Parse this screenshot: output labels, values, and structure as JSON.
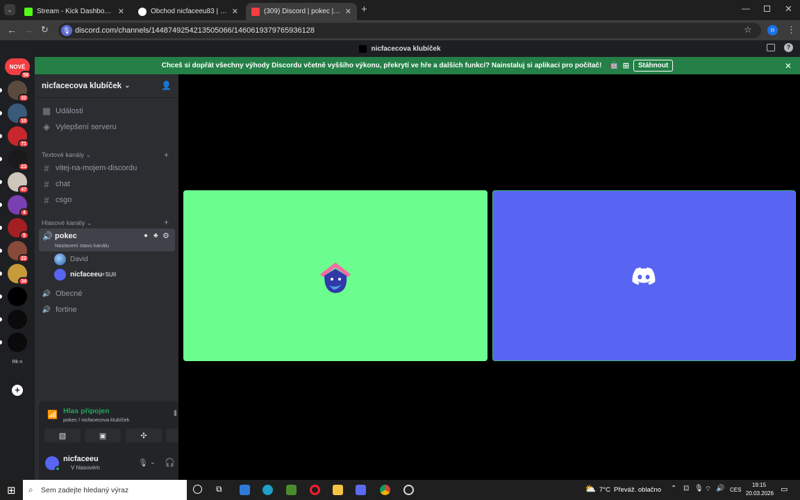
{
  "browser": {
    "tabs": [
      {
        "title": "Stream - Kick Dashboard",
        "active": false
      },
      {
        "title": "Obchod nicfaceeu83 | Nejlepší",
        "active": false
      },
      {
        "title": "(309) Discord | pokec | nicfacecova klubíček",
        "active": true
      }
    ],
    "new_tab": "+",
    "url": "discord.com/channels/1448749254213505066/1460619379765936128",
    "profile_initial": "n"
  },
  "window_title": "nicfacecova klubíček",
  "banner": {
    "text": "Chceš si dopřát všechny výhody Discordu včetně vyššího výkonu, překrytí ve hře a dalších funkcí? Nainstaluj si aplikaci pro počítač!",
    "download_label": "Stáhnout"
  },
  "rail": {
    "new_label": "NOVÉ",
    "new_badge": "58",
    "servers": [
      {
        "badge": "32",
        "color": "#5b4a3e"
      },
      {
        "badge": "10",
        "color": "#3a5a7a"
      },
      {
        "badge": "71",
        "color": "#c8272d"
      },
      {
        "badge": "23",
        "color": "#1a1a1a"
      },
      {
        "badge": "47",
        "color": "#cfc6bb"
      },
      {
        "badge": "4",
        "color": "#7a3fb0"
      },
      {
        "badge": "5",
        "color": "#a41f22"
      },
      {
        "badge": "22",
        "color": "#8a4a3a"
      },
      {
        "badge": "34",
        "color": "#c79a3a"
      },
      {
        "badge": "",
        "color": "#000000"
      },
      {
        "badge": "",
        "color": "#0a0a0a"
      },
      {
        "badge": "",
        "color": "#0a0a0a"
      }
    ],
    "folder_label": "Rk  n"
  },
  "sidebar": {
    "server_name": "nicfacecova klubíček",
    "events_label": "Události",
    "boost_label": "Vylepšení serveru",
    "text_category": "Textové kanály",
    "text_channels": [
      "vitej-na-mojem-discordu",
      "chat",
      "csgo"
    ],
    "voice_category": "Hlasové kanály",
    "active_voice": {
      "name": "pokec",
      "status": "Nastavení stavu kanálu"
    },
    "voice_members": [
      {
        "name": "David",
        "tag": ""
      },
      {
        "name": "nicfaceeu",
        "tag": "⚡SUII"
      }
    ],
    "other_voice": [
      "Obecné",
      "fortine"
    ]
  },
  "voice_panel": {
    "status": "Hlas připojen",
    "location": "pokec / nicfacecova klubíček"
  },
  "user": {
    "name": "nicfaceeu",
    "status": "V hlasovém"
  },
  "stage": {
    "tiles": [
      {
        "color": "#6cfd8f",
        "who": "David"
      },
      {
        "color": "#5865f2",
        "who": "nicfaceeu"
      }
    ]
  },
  "taskbar": {
    "search_placeholder": "Sem zadejte hledaný výraz",
    "weather": "7°C",
    "weather_desc": "Převáž. oblačno",
    "lang": "CES",
    "time": "19:15",
    "date": "20.03.2026"
  }
}
